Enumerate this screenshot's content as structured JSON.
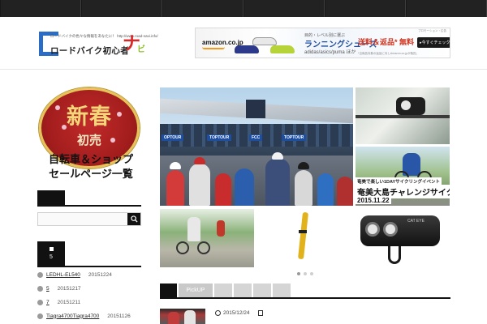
{
  "top_nav": {
    "items": [
      "",
      "",
      "",
      "",
      "",
      ""
    ]
  },
  "site": {
    "tagline": "ロードバイクの色々な情報をあなたに！ http://www.road-navi.info/",
    "title": "ロードバイク初心者",
    "title_navi": "ナ",
    "title_navi_small": "ビ"
  },
  "ad": {
    "small_label": "プロモーション・広告",
    "amazon": "amazon.co.jp",
    "line1": "目的・レベル別に選ぶ",
    "line2": "ランニングシューズ",
    "line3": "adidas/asics/puma ほか",
    "free": "送料＆返品* 無料",
    "check_button": "▸今すぐチェック",
    "note": "*当商品対象の返品に対しAmazon.co.jpが負担。"
  },
  "promo": {
    "big": "新春",
    "sub": "初売",
    "line1": "自転車＆ショップ",
    "line2": "セールページ一覧"
  },
  "sidebar": {
    "search_heading": "",
    "search_placeholder": "",
    "recent_heading": "5",
    "recent": [
      {
        "title": "LEDHL-EL540",
        "date": "20151224"
      },
      {
        "title": "5",
        "date": "20151217"
      },
      {
        "title": "7",
        "date": "20151211"
      },
      {
        "title": "Tiagra4700Tiagra4700",
        "date": "20151126"
      }
    ]
  },
  "slider": {
    "banners": [
      "OPTOUR",
      "TOPTOUR",
      "FCC",
      "TOPTOUR"
    ],
    "ride_caption_small": "奄美で楽しい1DAYサイクリングイベント",
    "ride_caption_big": "奄美大島チャレンジサイクリング",
    "ride_caption_date": "2015.11.22",
    "light_brand": "CAT EYE",
    "active_dot": 0
  },
  "tabs": {
    "items": [
      "",
      "PickUP",
      "",
      "",
      "",
      ""
    ]
  },
  "post": {
    "date": "2015/12/24"
  },
  "colors": {
    "accent": "#111111",
    "logo_blue": "#2b6cc4",
    "logo_red": "#d92626",
    "logo_green": "#8dbf2a"
  }
}
